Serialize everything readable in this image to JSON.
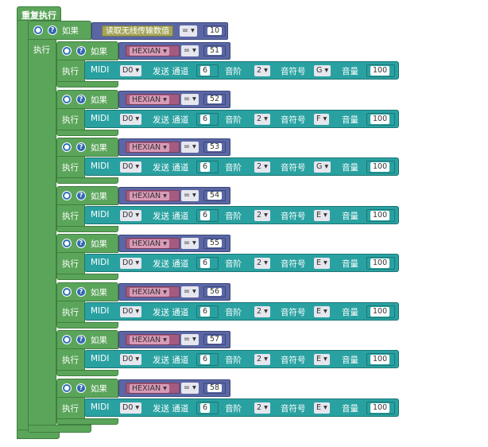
{
  "repeat": {
    "label": "重复执行"
  },
  "outer_if": {
    "if_label": "如果",
    "do_label": "执行",
    "source": "读取无线传输数值",
    "operator": "=",
    "value": "10"
  },
  "inner_ifs": [
    {
      "if_label": "如果",
      "do_label": "执行",
      "source": "HEXIAN",
      "operator": "=",
      "value": "51",
      "midi": {
        "label": "MIDI",
        "pin": "D0",
        "send_label": "发送 通道",
        "channel": "6",
        "octave_label": "音阶",
        "octave": "2",
        "note_label": "音符号",
        "note": "G",
        "volume_label": "音量",
        "volume": "100"
      }
    },
    {
      "if_label": "如果",
      "do_label": "执行",
      "source": "HEXIAN",
      "operator": "=",
      "value": "52",
      "midi": {
        "label": "MIDI",
        "pin": "D0",
        "send_label": "发送 通道",
        "channel": "6",
        "octave_label": "音阶",
        "octave": "2",
        "note_label": "音符号",
        "note": "F",
        "volume_label": "音量",
        "volume": "100"
      }
    },
    {
      "if_label": "如果",
      "do_label": "执行",
      "source": "HEXIAN",
      "operator": "=",
      "value": "53",
      "midi": {
        "label": "MIDI",
        "pin": "D0",
        "send_label": "发送 通道",
        "channel": "6",
        "octave_label": "音阶",
        "octave": "2",
        "note_label": "音符号",
        "note": "G",
        "volume_label": "音量",
        "volume": "100"
      }
    },
    {
      "if_label": "如果",
      "do_label": "执行",
      "source": "HEXIAN",
      "operator": "=",
      "value": "54",
      "midi": {
        "label": "MIDI",
        "pin": "D0",
        "send_label": "发送 通道",
        "channel": "6",
        "octave_label": "音阶",
        "octave": "2",
        "note_label": "音符号",
        "note": "E",
        "volume_label": "音量",
        "volume": "100"
      }
    },
    {
      "if_label": "如果",
      "do_label": "执行",
      "source": "HEXIAN",
      "operator": "=",
      "value": "55",
      "midi": {
        "label": "MIDI",
        "pin": "D0",
        "send_label": "发送 通道",
        "channel": "6",
        "octave_label": "音阶",
        "octave": "2",
        "note_label": "音符号",
        "note": "E",
        "volume_label": "音量",
        "volume": "100"
      }
    },
    {
      "if_label": "如果",
      "do_label": "执行",
      "source": "HEXIAN",
      "operator": "=",
      "value": "56",
      "midi": {
        "label": "MIDI",
        "pin": "D0",
        "send_label": "发送 通道",
        "channel": "6",
        "octave_label": "音阶",
        "octave": "2",
        "note_label": "音符号",
        "note": "E",
        "volume_label": "音量",
        "volume": "100"
      }
    },
    {
      "if_label": "如果",
      "do_label": "执行",
      "source": "HEXIAN",
      "operator": "=",
      "value": "57",
      "midi": {
        "label": "MIDI",
        "pin": "D0",
        "send_label": "发送 通道",
        "channel": "6",
        "octave_label": "音阶",
        "octave": "2",
        "note_label": "音符号",
        "note": "E",
        "volume_label": "音量",
        "volume": "100"
      }
    },
    {
      "if_label": "如果",
      "do_label": "执行",
      "source": "HEXIAN",
      "operator": "=",
      "value": "58",
      "midi": {
        "label": "MIDI",
        "pin": "D0",
        "send_label": "发送 通道",
        "channel": "6",
        "octave_label": "音阶",
        "octave": "2",
        "note_label": "音符号",
        "note": "E",
        "volume_label": "音量",
        "volume": "100"
      }
    }
  ],
  "icons": {
    "mutator": "gear-icon",
    "help": "question-icon",
    "dropdown": "triangle-down-icon"
  },
  "colors": {
    "loop_green": "#5ba55b",
    "logic_blue": "#5b67a5",
    "midi_teal": "#2aa1a1",
    "wireless_olive": "#a5a55b",
    "variable_pink": "#a55b80"
  }
}
